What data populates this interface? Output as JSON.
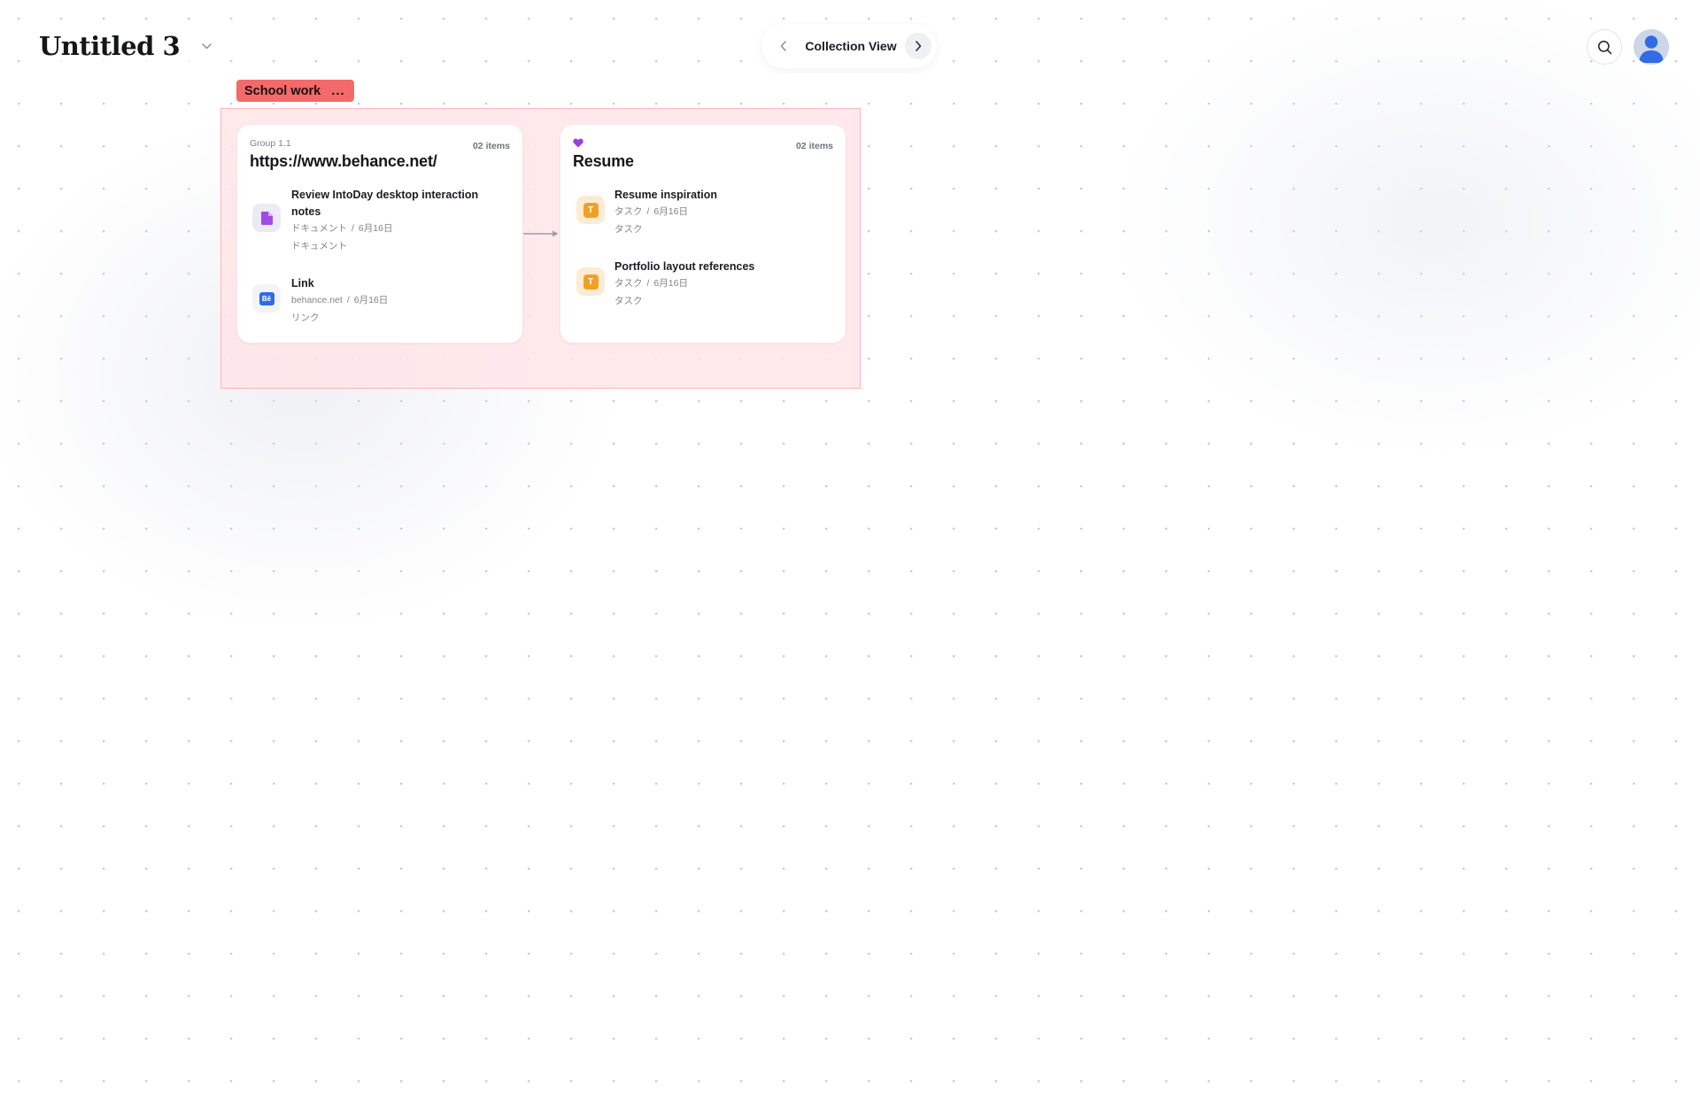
{
  "header": {
    "title": "Untitled 3"
  },
  "view_switch": {
    "label": "Collection View"
  },
  "group": {
    "name": "School work",
    "menu": "...",
    "color": "#f46a6a"
  },
  "cards": [
    {
      "sup": "Group 1.1",
      "title": "https://www.behance.net/",
      "count": "02 items",
      "items": [
        {
          "title": "Review IntoDay desktop interaction notes",
          "meta_type": "ドキュメント",
          "meta_sep": "/",
          "meta_date": "6月16日",
          "sub": "ドキュメント",
          "icon": "document-icon"
        },
        {
          "title": "Link",
          "meta_type": "behance.net",
          "meta_sep": "/",
          "meta_date": "6月16日",
          "sub": "リンク",
          "icon": "behance-icon",
          "icon_text": "Bē"
        }
      ]
    },
    {
      "title": "Resume",
      "count": "02 items",
      "icon": "heart-icon",
      "items": [
        {
          "title": "Resume inspiration",
          "meta_type": "タスク",
          "meta_sep": "/",
          "meta_date": "6月16日",
          "sub": "タスク",
          "icon": "task-icon",
          "icon_text": "T"
        },
        {
          "title": "Portfolio layout references",
          "meta_type": "タスク",
          "meta_sep": "/",
          "meta_date": "6月16日",
          "sub": "タスク",
          "icon": "task-icon",
          "icon_text": "T"
        }
      ]
    }
  ],
  "colors": {
    "accent_red": "#f46a6a",
    "frame_fill": "#ffe4e6",
    "document_purple": "#a24ae6",
    "behance_blue": "#2f6ce5",
    "task_orange": "#f2a024",
    "heart_purple": "#9b3fe0"
  }
}
